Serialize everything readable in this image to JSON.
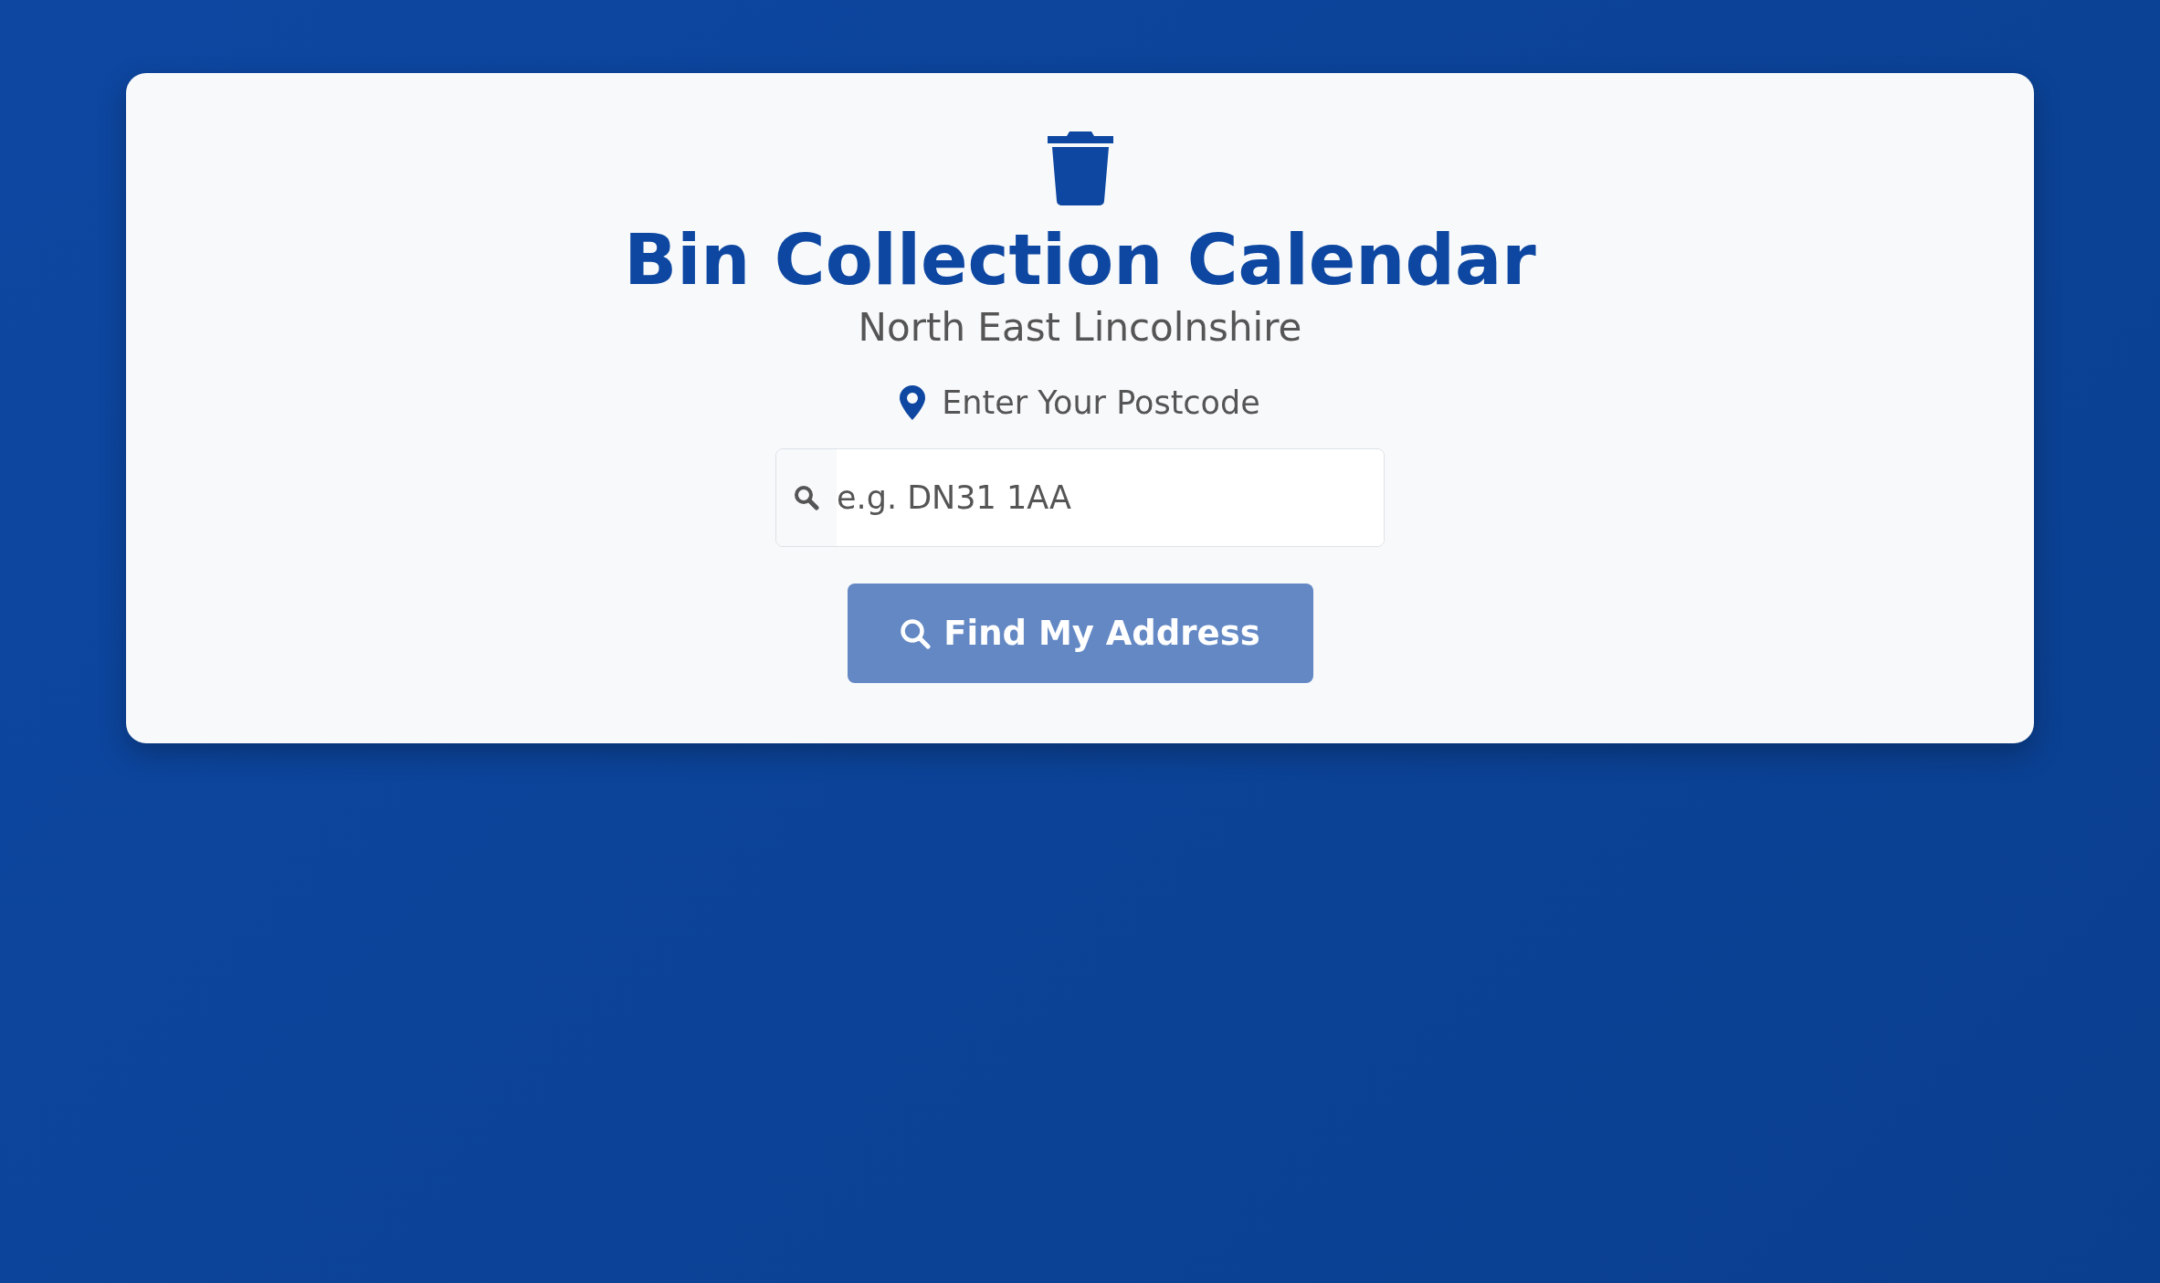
{
  "header": {
    "title": "Bin Collection Calendar",
    "subtitle": "North East Lincolnshire"
  },
  "postcode_form": {
    "label": "Enter Your Postcode",
    "placeholder": "e.g. DN31 1AA",
    "button": {
      "label": "Find My Address",
      "disabled": true
    }
  }
}
